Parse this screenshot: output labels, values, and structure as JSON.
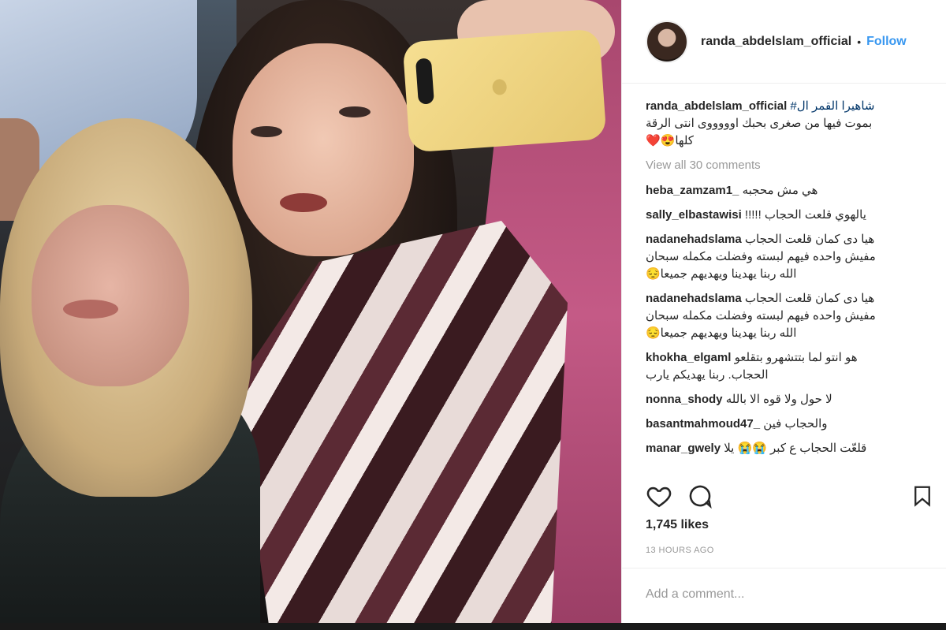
{
  "post": {
    "username": "randa_abdelslam_official",
    "separator": "•",
    "follow_label": "Follow",
    "caption": {
      "user": "randa_abdelslam_official",
      "hashtag": "شاهيرا القمر ال#",
      "line2": "بموت فيها من صغرى بحبك اوووووى انتى الرقة",
      "line3": "كلها😍❤️"
    },
    "view_all_label": "View all 30 comments",
    "comments": [
      {
        "user": "heba_zamzam1_",
        "text": "هي مش محجبه"
      },
      {
        "user": "sally_elbastawisi",
        "text": "يالهوي قلعت الحجاب !!!!!"
      },
      {
        "user": "nadanehadslama",
        "text": "هيا دى كمان قلعت الحجاب",
        "text2": "مفيش واحده فيهم لبسته وفضلت مكمله سبحان",
        "text3": "الله ربنا يهدينا ويهديهم جميعا😔"
      },
      {
        "user": "nadanehadslama",
        "text": "هيا دى كمان قلعت الحجاب",
        "text2": "مفيش واحده فيهم لبسته وفضلت مكمله سبحان",
        "text3": "الله ربنا يهدينا ويهديهم جميعا😔"
      },
      {
        "user": "khokha_elgaml",
        "text": "هو انتو لما بتتشهرو بتقلعو",
        "text2": "الحجاب. ربنا يهديكم يارب"
      },
      {
        "user": "nonna_shody",
        "text": "لا حول ولا قوه الا بالله"
      },
      {
        "user": "basantmahmoud47_",
        "text": "والحجاب فين"
      },
      {
        "user": "manar_gwely",
        "text": "قلعّت الحجاب ع كبر 😭😭 يلا"
      }
    ],
    "likes": "1,745 likes",
    "time": "13 HOURS AGO",
    "add_comment_placeholder": "Add a comment...",
    "icons": {
      "like": "heart-icon",
      "comment": "comment-bubble-icon",
      "save": "bookmark-icon"
    }
  },
  "colors": {
    "link": "#3897f0",
    "text": "#262626",
    "muted": "#999999",
    "hashtag": "#003569"
  }
}
